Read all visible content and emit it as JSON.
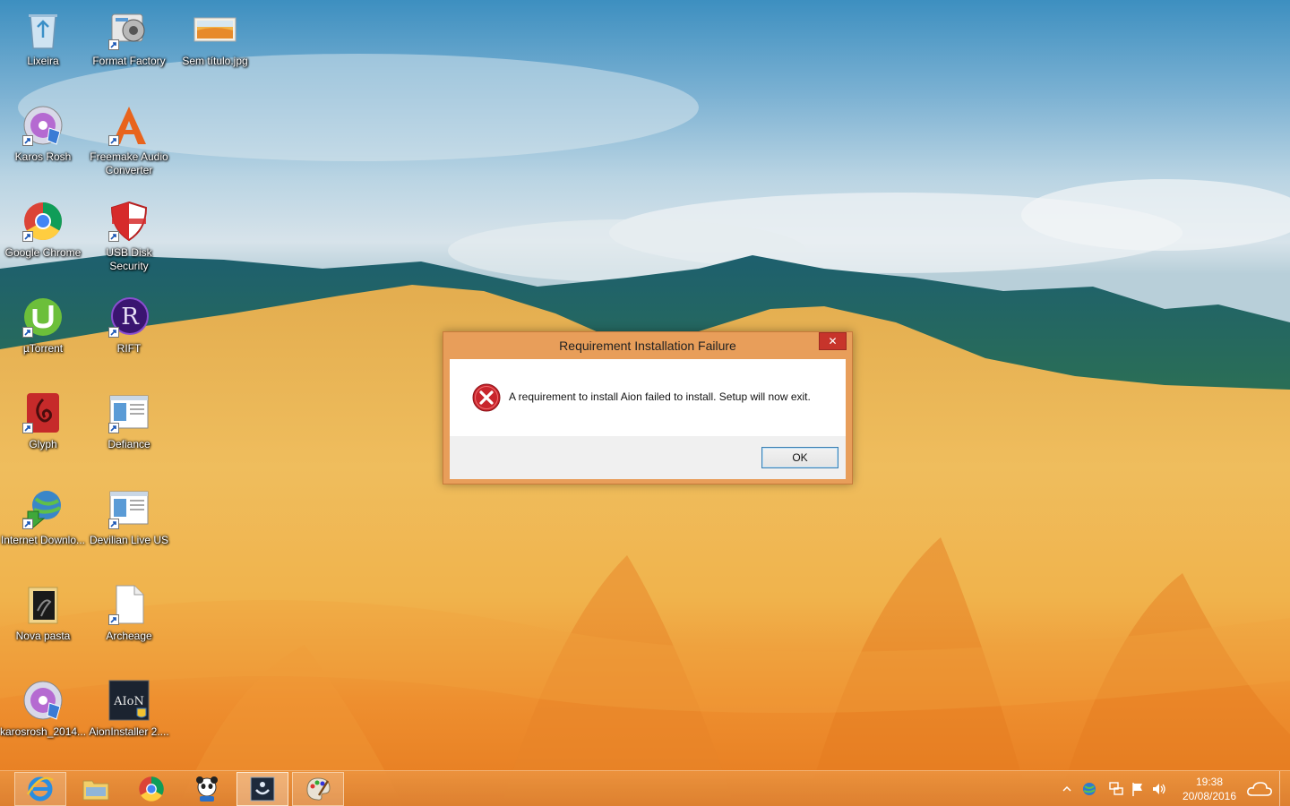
{
  "desktop": {
    "icons": [
      {
        "label": "Lixeira"
      },
      {
        "label": "Format Factory"
      },
      {
        "label": "Sem título.jpg"
      },
      {
        "label": "Karos Rosh"
      },
      {
        "label": "Freemake Audio Converter"
      },
      {
        "label": "Google Chrome"
      },
      {
        "label": "USB Disk Security"
      },
      {
        "label": "µTorrent"
      },
      {
        "label": "RIFT"
      },
      {
        "label": "Glyph"
      },
      {
        "label": "Defiance"
      },
      {
        "label": "Internet Downlo..."
      },
      {
        "label": "Devilian Live US"
      },
      {
        "label": "Nova pasta"
      },
      {
        "label": "Archeage"
      },
      {
        "label": "karosrosh_2014..."
      },
      {
        "label": "AionInstaller 2...."
      }
    ]
  },
  "dialog": {
    "title": "Requirement Installation Failure",
    "close_label": "✕",
    "message": "A requirement to install Aion failed to install. Setup will now exit.",
    "ok_label": "OK"
  },
  "taskbar": {
    "apps": [
      "Internet Explorer",
      "File Explorer",
      "Google Chrome",
      "Panda",
      "Aion Installer",
      "Paint"
    ],
    "clock_time": "19:38",
    "clock_date": "20/08/2016"
  },
  "colors": {
    "taskbar": "#e8903e",
    "dialog_frame": "#e89e5a",
    "close_button": "#c7342b"
  }
}
